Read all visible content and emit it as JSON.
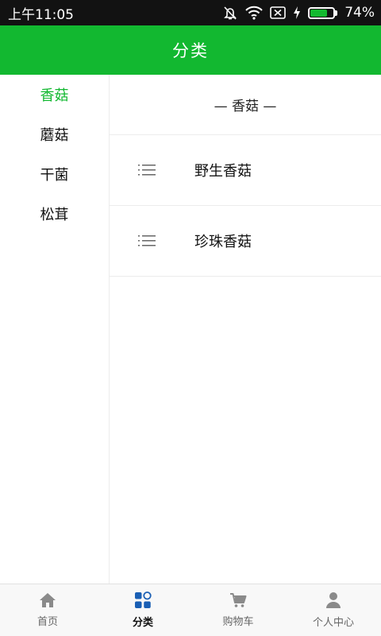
{
  "status_bar": {
    "time": "上午11:05",
    "battery_percent": "74%",
    "battery_level": 0.74
  },
  "header": {
    "title": "分类"
  },
  "sidebar": {
    "items": [
      {
        "label": "香菇",
        "active": true
      },
      {
        "label": "蘑菇",
        "active": false
      },
      {
        "label": "干菌",
        "active": false
      },
      {
        "label": "松茸",
        "active": false
      }
    ]
  },
  "content": {
    "section_title": "— 香菇 —",
    "items": [
      {
        "label": "野生香菇",
        "icon": "list-icon"
      },
      {
        "label": "珍珠香菇",
        "icon": "list-icon"
      }
    ]
  },
  "tabbar": {
    "tabs": [
      {
        "label": "首页",
        "icon": "home-icon",
        "active": false
      },
      {
        "label": "分类",
        "icon": "category-icon",
        "active": true
      },
      {
        "label": "购物车",
        "icon": "cart-icon",
        "active": false
      },
      {
        "label": "个人中心",
        "icon": "user-icon",
        "active": false
      }
    ]
  },
  "colors": {
    "brand_green": "#12b830",
    "status_bar": "#121212",
    "active_tab_icon": "#1a5fb4",
    "inactive_icon": "#8a8a8a"
  }
}
